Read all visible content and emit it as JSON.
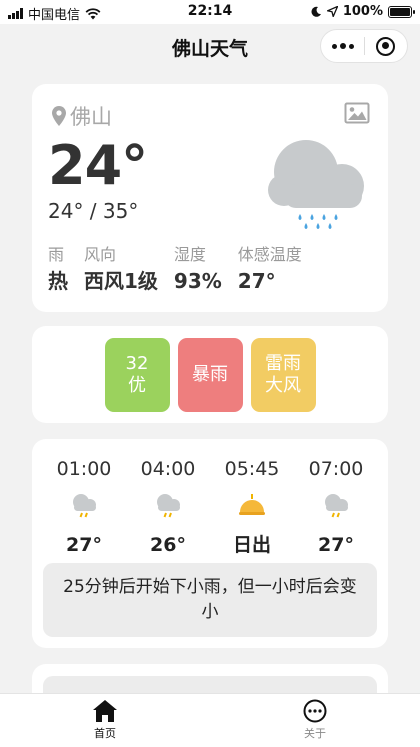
{
  "status_bar": {
    "carrier": "中国电信",
    "time": "22:14",
    "battery": "100%",
    "battery_level": 1.0
  },
  "nav": {
    "title": "佛山天气",
    "more_icon": "more-dots-icon",
    "close_icon": "close-circle-icon"
  },
  "current": {
    "city": "佛山",
    "temperature": "24°",
    "range": "24° / 35°",
    "condition_icon": "rain-cloud-icon",
    "metrics": [
      {
        "label": "雨",
        "value": "热"
      },
      {
        "label": "风向",
        "value": "西风1级"
      },
      {
        "label": "湿度",
        "value": "93%"
      },
      {
        "label": "体感温度",
        "value": "27°"
      }
    ]
  },
  "alerts": {
    "aqi": {
      "value": "32",
      "level": "优",
      "color": "#9bd25d"
    },
    "warning1": {
      "text": "暴雨",
      "color": "#ee7e7e"
    },
    "warning2": {
      "line1": "雷雨",
      "line2": "大风",
      "color": "#f2cc63"
    }
  },
  "hourly": {
    "items": [
      {
        "time": "01:00",
        "icon": "rain-cloud-icon",
        "temp": "27°"
      },
      {
        "time": "04:00",
        "icon": "rain-cloud-icon",
        "temp": "26°"
      },
      {
        "time": "05:45",
        "icon": "sunrise-icon",
        "temp": "日出"
      },
      {
        "time": "07:00",
        "icon": "rain-cloud-icon",
        "temp": "27°"
      }
    ],
    "summary": "25分钟后开始下小雨，但一小时后会变小"
  },
  "tabbar": {
    "home": {
      "label": "首页",
      "icon": "home-icon"
    },
    "about": {
      "label": "关于",
      "icon": "more-circle-icon"
    }
  }
}
